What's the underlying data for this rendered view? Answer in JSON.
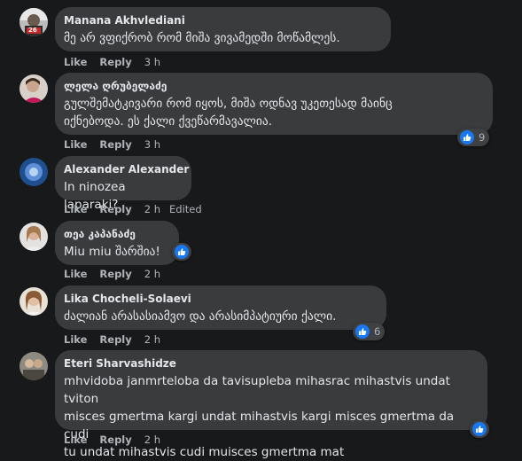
{
  "actions": {
    "like": "Like",
    "reply": "Reply"
  },
  "comments": [
    {
      "name": "Manana Akhvlediani",
      "lines": [
        "მე არ ვფიქრობ რომ მიშა ვივამედში მოწამლეს."
      ],
      "time": "3 h",
      "edited": "",
      "reactions": ""
    },
    {
      "name": "ლელა ღრუბელაძე",
      "lines": [
        "გულშემატკივარი რომ იყოს, მიშა ოდნავ უკეთესად მაინც",
        "იქნებოდა. ეს ქალი ქვეწარმავალია."
      ],
      "time": "3 h",
      "edited": "",
      "reactions": "9"
    },
    {
      "name": "Alexander Alexander",
      "lines": [
        "In ninozea laparaki?"
      ],
      "time": "2 h",
      "edited": "Edited",
      "reactions": ""
    },
    {
      "name": "თეა კაპანაძე",
      "lines": [
        "Miu miu შარშია!"
      ],
      "time": "2 h",
      "edited": "",
      "reactions": ""
    },
    {
      "name": "Lika Chocheli-Solaevi",
      "lines": [
        "ძალიან არასასიამვო და არასიმპატიური ქალი."
      ],
      "time": "2 h",
      "edited": "",
      "reactions": "6"
    },
    {
      "name": "Eteri Sharvashidze",
      "lines": [
        "mhvidoba janmrteloba da tavisupleba mihasrac mihastvis undat tviton",
        "misces gmertma kargi undat mihastvis kargi misces gmertma da cudi",
        "tu undat mihastvis cudi muisces gmertma mat"
      ],
      "time": "2 h",
      "edited": "",
      "reactions": ""
    }
  ],
  "avatar_badge": "26",
  "colors": {
    "background": "#18191a",
    "bubble": "#3a3b3c",
    "like_blue": "#1877f2",
    "secondary_text": "#b0b3b8"
  }
}
